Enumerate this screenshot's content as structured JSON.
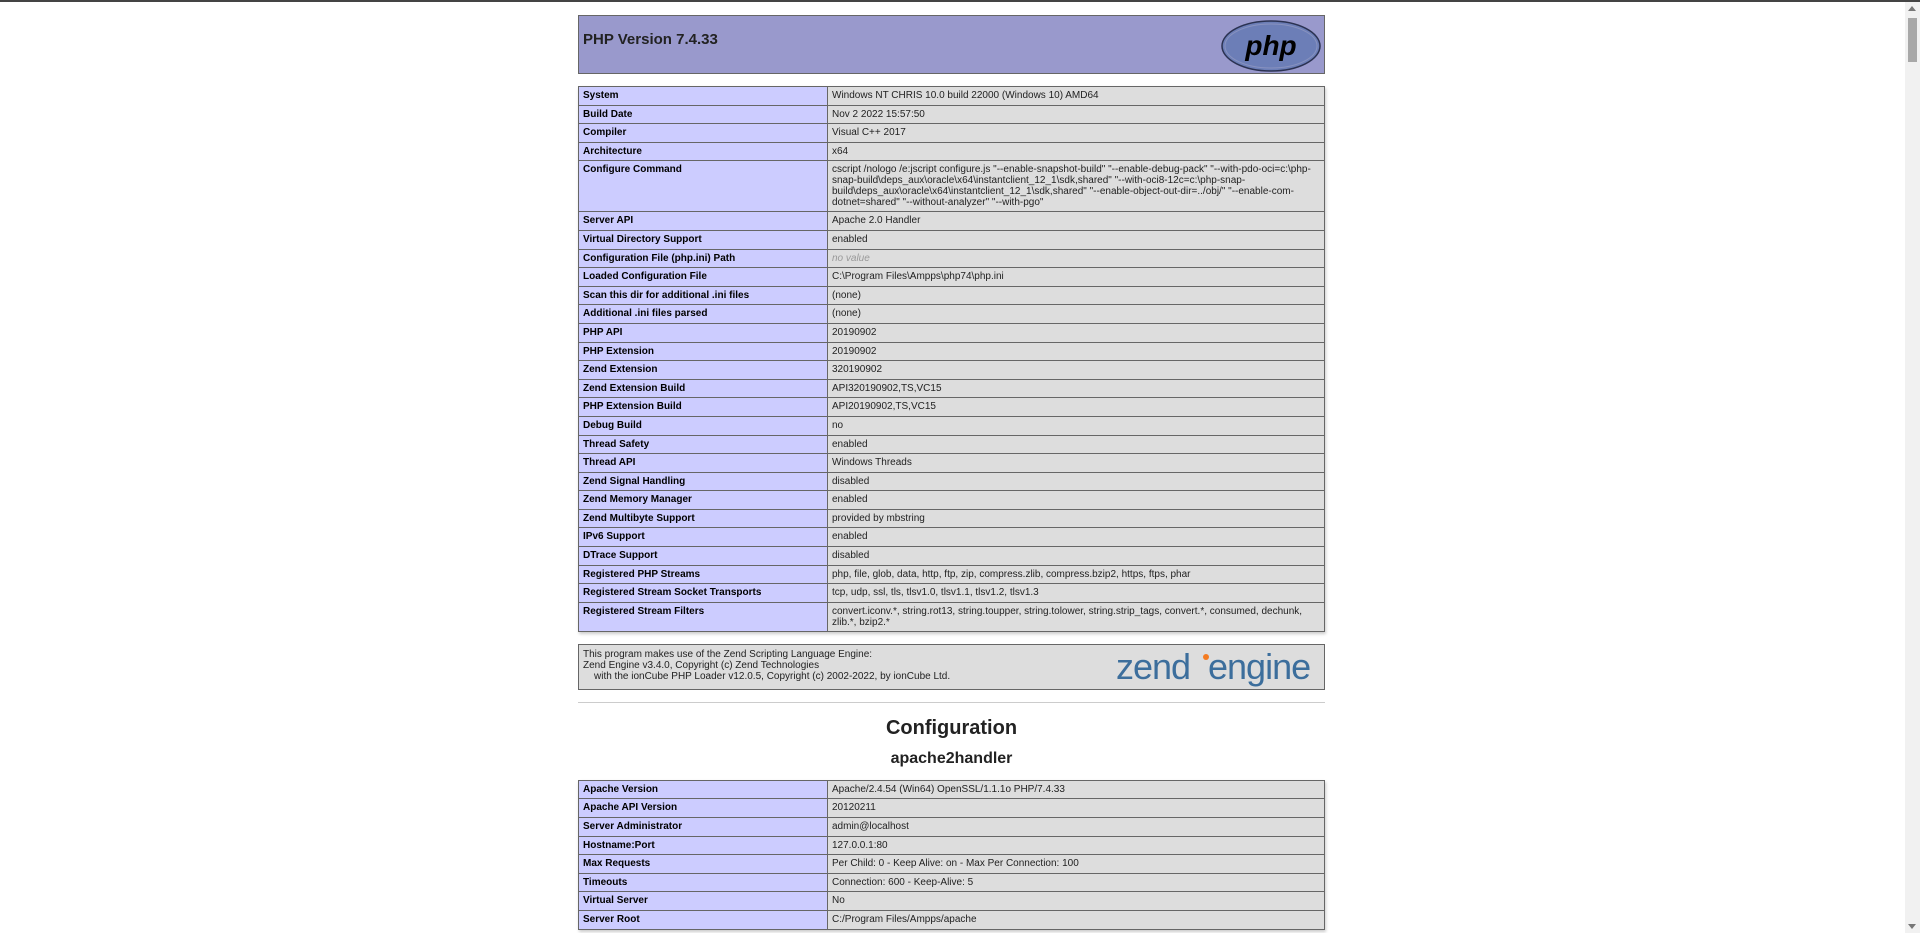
{
  "header": {
    "title": "PHP Version 7.4.33",
    "logo_text": "php"
  },
  "info_rows": [
    {
      "k": "System",
      "v": "Windows NT CHRIS 10.0 build 22000 (Windows 10) AMD64"
    },
    {
      "k": "Build Date",
      "v": "Nov 2 2022 15:57:50"
    },
    {
      "k": "Compiler",
      "v": "Visual C++ 2017"
    },
    {
      "k": "Architecture",
      "v": "x64"
    },
    {
      "k": "Configure Command",
      "v": "cscript /nologo /e:jscript configure.js \"--enable-snapshot-build\" \"--enable-debug-pack\" \"--with-pdo-oci=c:\\php-snap-build\\deps_aux\\oracle\\x64\\instantclient_12_1\\sdk,shared\" \"--with-oci8-12c=c:\\php-snap-build\\deps_aux\\oracle\\x64\\instantclient_12_1\\sdk,shared\" \"--enable-object-out-dir=../obj/\" \"--enable-com-dotnet=shared\" \"--without-analyzer\" \"--with-pgo\""
    },
    {
      "k": "Server API",
      "v": "Apache 2.0 Handler"
    },
    {
      "k": "Virtual Directory Support",
      "v": "enabled"
    },
    {
      "k": "Configuration File (php.ini) Path",
      "v": "no value",
      "novalue": true
    },
    {
      "k": "Loaded Configuration File",
      "v": "C:\\Program Files\\Ampps\\php74\\php.ini"
    },
    {
      "k": "Scan this dir for additional .ini files",
      "v": "(none)"
    },
    {
      "k": "Additional .ini files parsed",
      "v": "(none)"
    },
    {
      "k": "PHP API",
      "v": "20190902"
    },
    {
      "k": "PHP Extension",
      "v": "20190902"
    },
    {
      "k": "Zend Extension",
      "v": "320190902"
    },
    {
      "k": "Zend Extension Build",
      "v": "API320190902,TS,VC15"
    },
    {
      "k": "PHP Extension Build",
      "v": "API20190902,TS,VC15"
    },
    {
      "k": "Debug Build",
      "v": "no"
    },
    {
      "k": "Thread Safety",
      "v": "enabled"
    },
    {
      "k": "Thread API",
      "v": "Windows Threads"
    },
    {
      "k": "Zend Signal Handling",
      "v": "disabled"
    },
    {
      "k": "Zend Memory Manager",
      "v": "enabled"
    },
    {
      "k": "Zend Multibyte Support",
      "v": "provided by mbstring"
    },
    {
      "k": "IPv6 Support",
      "v": "enabled"
    },
    {
      "k": "DTrace Support",
      "v": "disabled"
    },
    {
      "k": "Registered PHP Streams",
      "v": "php, file, glob, data, http, ftp, zip, compress.zlib, compress.bzip2, https, ftps, phar"
    },
    {
      "k": "Registered Stream Socket Transports",
      "v": "tcp, udp, ssl, tls, tlsv1.0, tlsv1.1, tlsv1.2, tlsv1.3"
    },
    {
      "k": "Registered Stream Filters",
      "v": "convert.iconv.*, string.rot13, string.toupper, string.tolower, string.strip_tags, convert.*, consumed, dechunk, zlib.*, bzip2.*"
    }
  ],
  "zend": {
    "line1": "This program makes use of the Zend Scripting Language Engine:",
    "line2": "Zend Engine v3.4.0, Copyright (c) Zend Technologies",
    "line3": "with the ionCube PHP Loader v12.0.5, Copyright (c) 2002-2022, by ionCube Ltd.",
    "logo_text": "zendengine"
  },
  "configuration": {
    "title": "Configuration",
    "section": "apache2handler",
    "rows": [
      {
        "k": "Apache Version",
        "v": "Apache/2.4.54 (Win64) OpenSSL/1.1.1o PHP/7.4.33"
      },
      {
        "k": "Apache API Version",
        "v": "20120211"
      },
      {
        "k": "Server Administrator",
        "v": "admin@localhost"
      },
      {
        "k": "Hostname:Port",
        "v": "127.0.0.1:80"
      },
      {
        "k": "Max Requests",
        "v": "Per Child: 0 - Keep Alive: on - Max Per Connection: 100"
      },
      {
        "k": "Timeouts",
        "v": "Connection: 600 - Keep-Alive: 5"
      },
      {
        "k": "Virtual Server",
        "v": "No"
      },
      {
        "k": "Server Root",
        "v": "C:/Program Files/Ampps/apache"
      }
    ]
  },
  "colors": {
    "header_bg": "#9999cc",
    "key_bg": "#ccccff",
    "value_bg": "#dddddd"
  }
}
